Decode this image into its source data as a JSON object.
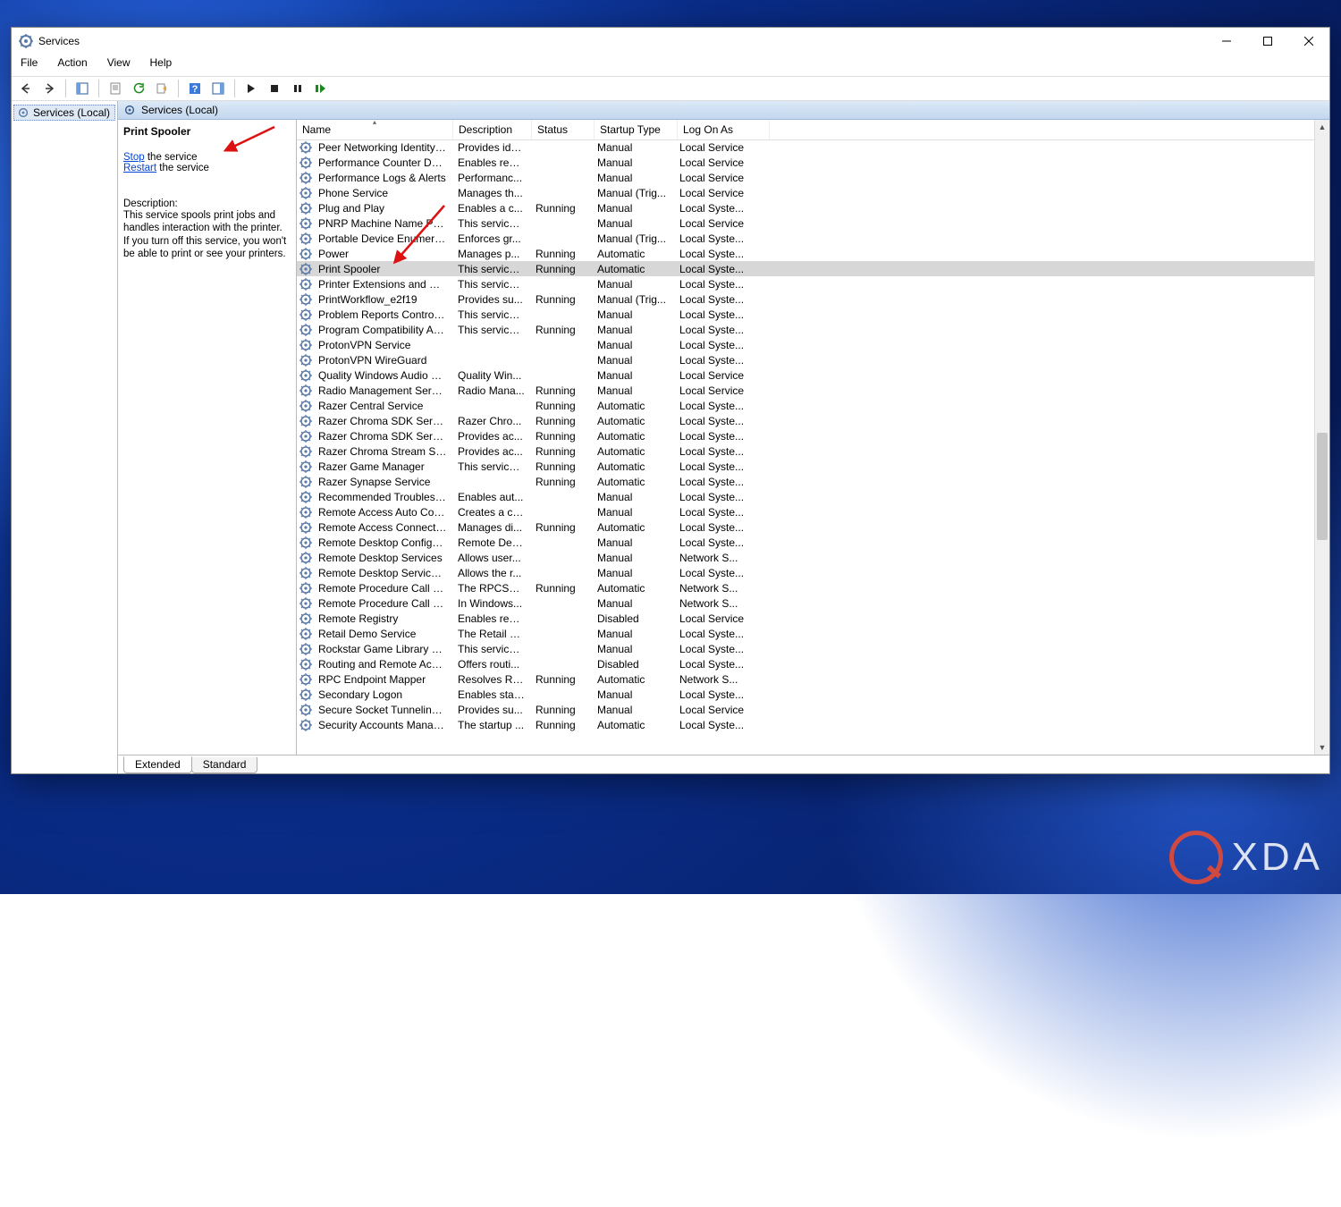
{
  "window": {
    "title": "Services"
  },
  "menu": {
    "file": "File",
    "action": "Action",
    "view": "View",
    "help": "Help"
  },
  "tree": {
    "root": "Services (Local)"
  },
  "content_header": "Services (Local)",
  "detail": {
    "title": "Print Spooler",
    "stop": "Stop",
    "stop_rest": " the service",
    "restart": "Restart",
    "restart_rest": " the service",
    "desc_label": "Description:",
    "desc": "This service spools print jobs and handles interaction with the printer. If you turn off this service, you won't be able to print or see your printers."
  },
  "columns": {
    "name": "Name",
    "description": "Description",
    "status": "Status",
    "startup": "Startup Type",
    "logon": "Log On As"
  },
  "tabs": {
    "extended": "Extended",
    "standard": "Standard"
  },
  "services": [
    {
      "name": "Peer Networking Identity M...",
      "desc": "Provides ide...",
      "status": "",
      "startup": "Manual",
      "logon": "Local Service"
    },
    {
      "name": "Performance Counter DLL ...",
      "desc": "Enables rem...",
      "status": "",
      "startup": "Manual",
      "logon": "Local Service"
    },
    {
      "name": "Performance Logs & Alerts",
      "desc": "Performanc...",
      "status": "",
      "startup": "Manual",
      "logon": "Local Service"
    },
    {
      "name": "Phone Service",
      "desc": "Manages th...",
      "status": "",
      "startup": "Manual (Trig...",
      "logon": "Local Service"
    },
    {
      "name": "Plug and Play",
      "desc": "Enables a c...",
      "status": "Running",
      "startup": "Manual",
      "logon": "Local Syste..."
    },
    {
      "name": "PNRP Machine Name Publi...",
      "desc": "This service ...",
      "status": "",
      "startup": "Manual",
      "logon": "Local Service"
    },
    {
      "name": "Portable Device Enumerator...",
      "desc": "Enforces gr...",
      "status": "",
      "startup": "Manual (Trig...",
      "logon": "Local Syste..."
    },
    {
      "name": "Power",
      "desc": "Manages p...",
      "status": "Running",
      "startup": "Automatic",
      "logon": "Local Syste..."
    },
    {
      "name": "Print Spooler",
      "desc": "This service ...",
      "status": "Running",
      "startup": "Automatic",
      "logon": "Local Syste...",
      "selected": true
    },
    {
      "name": "Printer Extensions and Notif...",
      "desc": "This service ...",
      "status": "",
      "startup": "Manual",
      "logon": "Local Syste..."
    },
    {
      "name": "PrintWorkflow_e2f19",
      "desc": "Provides su...",
      "status": "Running",
      "startup": "Manual (Trig...",
      "logon": "Local Syste..."
    },
    {
      "name": "Problem Reports Control Pa...",
      "desc": "This service ...",
      "status": "",
      "startup": "Manual",
      "logon": "Local Syste..."
    },
    {
      "name": "Program Compatibility Assi...",
      "desc": "This service ...",
      "status": "Running",
      "startup": "Manual",
      "logon": "Local Syste..."
    },
    {
      "name": "ProtonVPN Service",
      "desc": "",
      "status": "",
      "startup": "Manual",
      "logon": "Local Syste..."
    },
    {
      "name": "ProtonVPN WireGuard",
      "desc": "",
      "status": "",
      "startup": "Manual",
      "logon": "Local Syste..."
    },
    {
      "name": "Quality Windows Audio Vid...",
      "desc": "Quality Win...",
      "status": "",
      "startup": "Manual",
      "logon": "Local Service"
    },
    {
      "name": "Radio Management Service",
      "desc": "Radio Mana...",
      "status": "Running",
      "startup": "Manual",
      "logon": "Local Service"
    },
    {
      "name": "Razer Central Service",
      "desc": "",
      "status": "Running",
      "startup": "Automatic",
      "logon": "Local Syste..."
    },
    {
      "name": "Razer Chroma SDK Server",
      "desc": "Razer Chro...",
      "status": "Running",
      "startup": "Automatic",
      "logon": "Local Syste..."
    },
    {
      "name": "Razer Chroma SDK Service",
      "desc": "Provides ac...",
      "status": "Running",
      "startup": "Automatic",
      "logon": "Local Syste..."
    },
    {
      "name": "Razer Chroma Stream Server",
      "desc": "Provides ac...",
      "status": "Running",
      "startup": "Automatic",
      "logon": "Local Syste..."
    },
    {
      "name": "Razer Game Manager",
      "desc": "This service ...",
      "status": "Running",
      "startup": "Automatic",
      "logon": "Local Syste..."
    },
    {
      "name": "Razer Synapse Service",
      "desc": "",
      "status": "Running",
      "startup": "Automatic",
      "logon": "Local Syste..."
    },
    {
      "name": "Recommended Troublesho...",
      "desc": "Enables aut...",
      "status": "",
      "startup": "Manual",
      "logon": "Local Syste..."
    },
    {
      "name": "Remote Access Auto Conne...",
      "desc": "Creates a co...",
      "status": "",
      "startup": "Manual",
      "logon": "Local Syste..."
    },
    {
      "name": "Remote Access Connection...",
      "desc": "Manages di...",
      "status": "Running",
      "startup": "Automatic",
      "logon": "Local Syste..."
    },
    {
      "name": "Remote Desktop Configurat...",
      "desc": "Remote Des...",
      "status": "",
      "startup": "Manual",
      "logon": "Local Syste..."
    },
    {
      "name": "Remote Desktop Services",
      "desc": "Allows user...",
      "status": "",
      "startup": "Manual",
      "logon": "Network S..."
    },
    {
      "name": "Remote Desktop Services U...",
      "desc": "Allows the r...",
      "status": "",
      "startup": "Manual",
      "logon": "Local Syste..."
    },
    {
      "name": "Remote Procedure Call (RPC)",
      "desc": "The RPCSS s...",
      "status": "Running",
      "startup": "Automatic",
      "logon": "Network S..."
    },
    {
      "name": "Remote Procedure Call (RP...",
      "desc": "In Windows...",
      "status": "",
      "startup": "Manual",
      "logon": "Network S..."
    },
    {
      "name": "Remote Registry",
      "desc": "Enables rem...",
      "status": "",
      "startup": "Disabled",
      "logon": "Local Service"
    },
    {
      "name": "Retail Demo Service",
      "desc": "The Retail D...",
      "status": "",
      "startup": "Manual",
      "logon": "Local Syste..."
    },
    {
      "name": "Rockstar Game Library Servi...",
      "desc": "This service ...",
      "status": "",
      "startup": "Manual",
      "logon": "Local Syste..."
    },
    {
      "name": "Routing and Remote Access",
      "desc": "Offers routi...",
      "status": "",
      "startup": "Disabled",
      "logon": "Local Syste..."
    },
    {
      "name": "RPC Endpoint Mapper",
      "desc": "Resolves RP...",
      "status": "Running",
      "startup": "Automatic",
      "logon": "Network S..."
    },
    {
      "name": "Secondary Logon",
      "desc": "Enables star...",
      "status": "",
      "startup": "Manual",
      "logon": "Local Syste..."
    },
    {
      "name": "Secure Socket Tunneling Pr...",
      "desc": "Provides su...",
      "status": "Running",
      "startup": "Manual",
      "logon": "Local Service"
    },
    {
      "name": "Security Accounts Manager",
      "desc": "The startup ...",
      "status": "Running",
      "startup": "Automatic",
      "logon": "Local Syste..."
    }
  ]
}
